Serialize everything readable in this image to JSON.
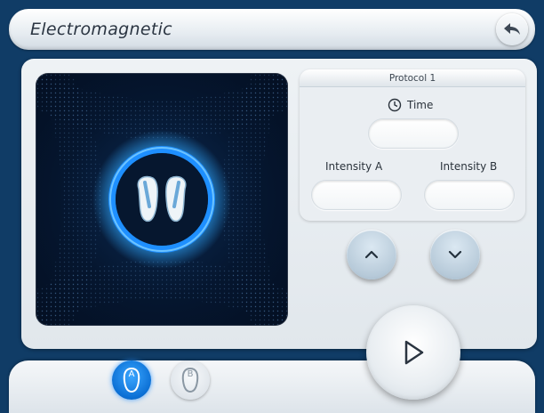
{
  "header": {
    "title": "Electromagnetic"
  },
  "protocol": {
    "title": "Protocol 1",
    "time_label": "Time",
    "time_value": "",
    "intensity_a_label": "Intensity A",
    "intensity_a_value": "",
    "intensity_b_label": "Intensity B",
    "intensity_b_value": ""
  },
  "channels": [
    {
      "letter": "A",
      "active": true
    },
    {
      "letter": "B",
      "active": false
    }
  ],
  "colors": {
    "background": "#103c66",
    "accent": "#0b6fd4",
    "glow": "#2fa8ff"
  },
  "icons": {
    "back": "back-arrow-icon",
    "clock": "clock-icon",
    "up": "chevron-up-icon",
    "down": "chevron-down-icon",
    "play": "play-icon",
    "applicator": "applicator-pads-icon"
  }
}
